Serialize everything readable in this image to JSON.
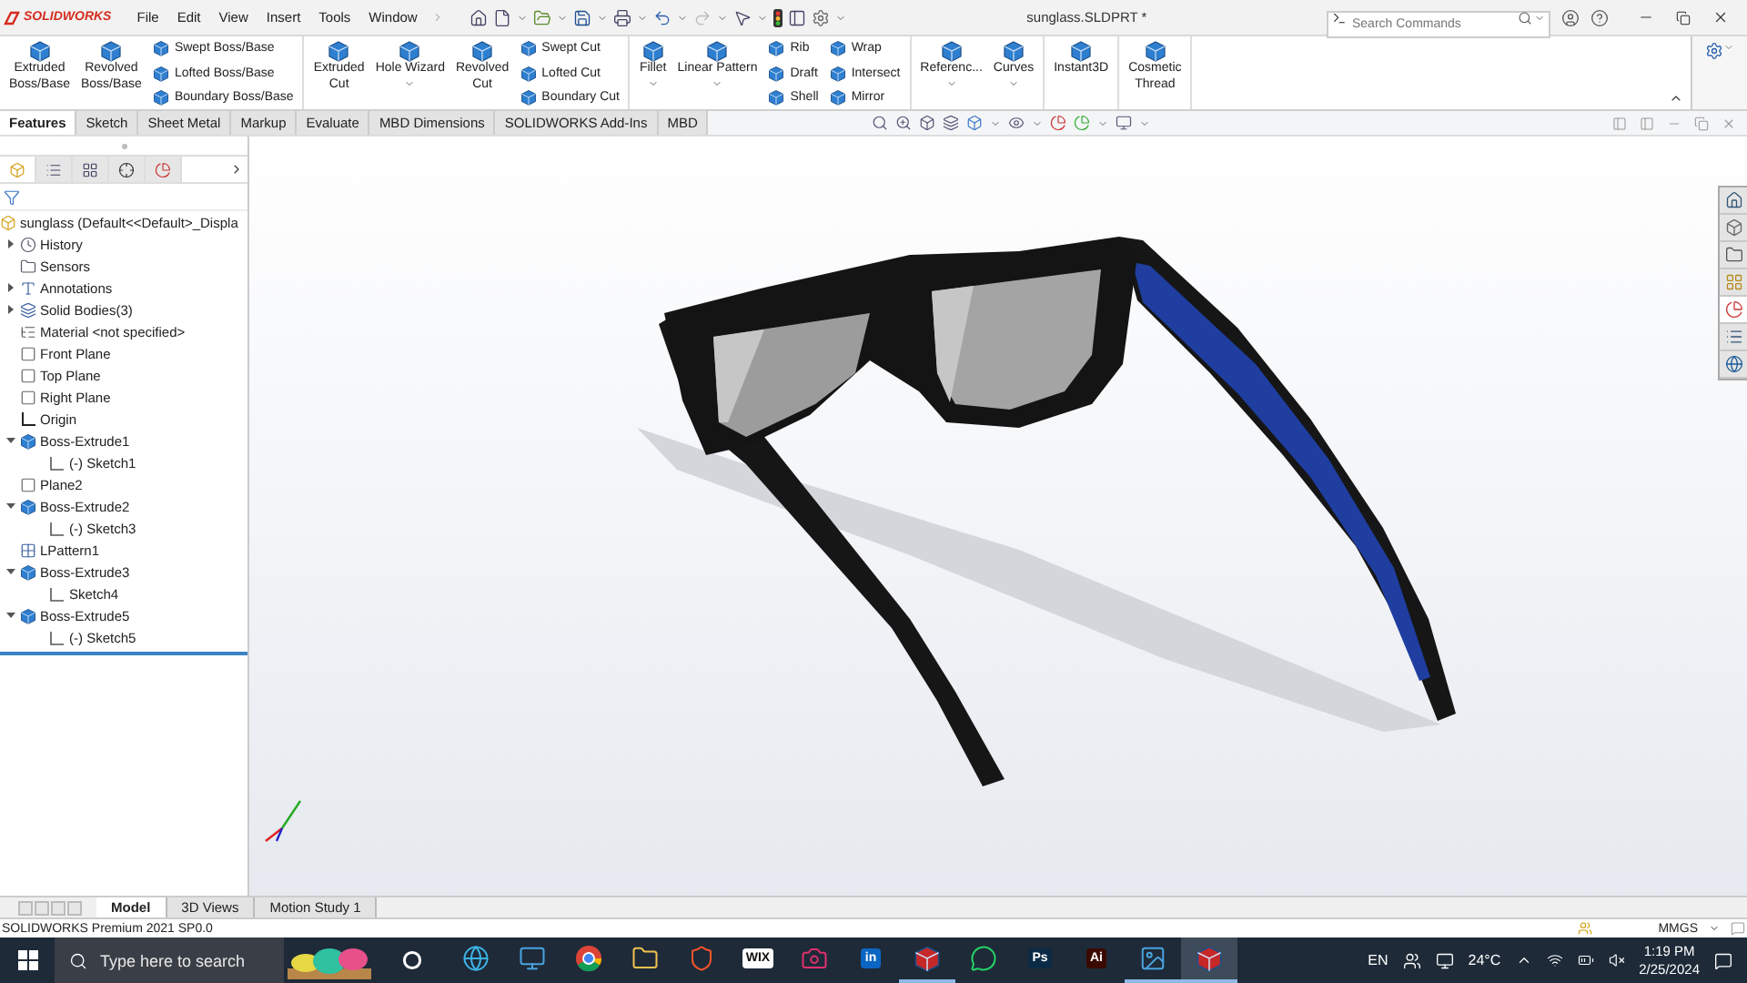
{
  "title_bar": {
    "logo": "SOLIDWORKS",
    "menus": [
      "File",
      "Edit",
      "View",
      "Insert",
      "Tools",
      "Window"
    ],
    "document_title": "sunglass.SLDPRT *",
    "search": {
      "placeholder": "Search Commands"
    }
  },
  "ribbon": {
    "groups": [
      {
        "items": [
          {
            "kind": "large",
            "label": "Extruded\nBoss/Base",
            "has_menu": false
          },
          {
            "kind": "large",
            "label": "Revolved\nBoss/Base",
            "has_menu": false
          },
          {
            "kind": "stack",
            "entries": [
              "Swept Boss/Base",
              "Lofted Boss/Base",
              "Boundary Boss/Base"
            ]
          }
        ]
      },
      {
        "items": [
          {
            "kind": "large",
            "label": "Extruded\nCut",
            "has_menu": false
          },
          {
            "kind": "large",
            "label": "Hole Wizard",
            "has_menu": true
          },
          {
            "kind": "large",
            "label": "Revolved\nCut",
            "has_menu": false
          },
          {
            "kind": "stack",
            "entries": [
              "Swept Cut",
              "Lofted Cut",
              "Boundary Cut"
            ]
          }
        ]
      },
      {
        "items": [
          {
            "kind": "large",
            "label": "Fillet",
            "has_menu": true
          },
          {
            "kind": "large",
            "label": "Linear Pattern",
            "has_menu": true
          },
          {
            "kind": "stack",
            "entries": [
              "Rib",
              "Draft",
              "Shell"
            ]
          },
          {
            "kind": "stack",
            "entries": [
              "Wrap",
              "Intersect",
              "Mirror"
            ]
          }
        ]
      },
      {
        "items": [
          {
            "kind": "large",
            "label": "Referenc...",
            "has_menu": true
          },
          {
            "kind": "large",
            "label": "Curves",
            "has_menu": true
          }
        ]
      },
      {
        "items": [
          {
            "kind": "large",
            "label": "Instant3D",
            "has_menu": false
          }
        ]
      },
      {
        "items": [
          {
            "kind": "large",
            "label": "Cosmetic\nThread",
            "has_menu": false
          }
        ]
      }
    ]
  },
  "command_tabs": [
    {
      "label": "Features",
      "selected": true
    },
    {
      "label": "Sketch",
      "selected": false
    },
    {
      "label": "Sheet Metal",
      "selected": false
    },
    {
      "label": "Markup",
      "selected": false
    },
    {
      "label": "Evaluate",
      "selected": false
    },
    {
      "label": "MBD Dimensions",
      "selected": false
    },
    {
      "label": "SOLIDWORKS Add-Ins",
      "selected": false
    },
    {
      "label": "MBD",
      "selected": false
    }
  ],
  "feature_tree": {
    "tabs": [
      {
        "selected": true
      },
      {
        "selected": false
      },
      {
        "selected": false
      },
      {
        "selected": false
      },
      {
        "selected": false
      }
    ],
    "root": "sunglass  (Default<<Default>_Displa",
    "items": [
      {
        "kind": "history",
        "label": "History",
        "expanded": false
      },
      {
        "kind": "sensors",
        "label": "Sensors"
      },
      {
        "kind": "annotations",
        "label": "Annotations",
        "expanded": false
      },
      {
        "kind": "bodies",
        "label": "Solid Bodies(3)",
        "expanded": false
      },
      {
        "kind": "material",
        "label": "Material <not specified>"
      },
      {
        "kind": "plane",
        "label": "Front Plane"
      },
      {
        "kind": "plane",
        "label": "Top Plane"
      },
      {
        "kind": "plane",
        "label": "Right Plane"
      },
      {
        "kind": "origin",
        "label": "Origin"
      },
      {
        "kind": "feature",
        "label": "Boss-Extrude1",
        "expanded": true,
        "children": [
          {
            "kind": "sketch",
            "label": "(-) Sketch1"
          }
        ]
      },
      {
        "kind": "plane",
        "label": "Plane2"
      },
      {
        "kind": "feature",
        "label": "Boss-Extrude2",
        "expanded": true,
        "children": [
          {
            "kind": "sketch",
            "label": "(-) Sketch3"
          }
        ]
      },
      {
        "kind": "pattern",
        "label": "LPattern1"
      },
      {
        "kind": "feature",
        "label": "Boss-Extrude3",
        "expanded": true,
        "children": [
          {
            "kind": "sketch",
            "label": "Sketch4"
          }
        ]
      },
      {
        "kind": "feature",
        "label": "Boss-Extrude5",
        "expanded": true,
        "children": [
          {
            "kind": "sketch",
            "label": "(-) Sketch5"
          }
        ]
      }
    ]
  },
  "task_pane": [
    {
      "kind": "home",
      "selected": false
    },
    {
      "kind": "parts",
      "selected": false
    },
    {
      "kind": "folder",
      "selected": false
    },
    {
      "kind": "grid",
      "selected": false
    },
    {
      "kind": "appearance",
      "selected": true
    },
    {
      "kind": "list",
      "selected": false
    },
    {
      "kind": "globe",
      "selected": false
    }
  ],
  "bottom_tabs": [
    {
      "label": "Model",
      "selected": true
    },
    {
      "label": "3D Views",
      "selected": false
    },
    {
      "label": "Motion Study 1",
      "selected": false
    }
  ],
  "status_bar": {
    "text": "SOLIDWORKS Premium 2021 SP0.0",
    "units": "MMGS"
  },
  "taskbar": {
    "search": {
      "placeholder": "Type here to search"
    },
    "apps": [
      {
        "kind": "browser",
        "running": false,
        "active": false
      },
      {
        "kind": "remote",
        "running": false,
        "active": false
      },
      {
        "kind": "chrome",
        "running": false,
        "active": false
      },
      {
        "kind": "files",
        "running": false,
        "active": false
      },
      {
        "kind": "shield",
        "running": false,
        "active": false
      },
      {
        "kind": "tile",
        "label": "WIX",
        "color": "#ffffff",
        "running": false,
        "active": false
      },
      {
        "kind": "camera",
        "running": false,
        "active": false
      },
      {
        "kind": "tile",
        "label": "in",
        "color": "#0a66c2",
        "running": false,
        "active": false
      },
      {
        "kind": "cube",
        "running": true,
        "active": false
      },
      {
        "kind": "chat",
        "running": false,
        "active": false
      },
      {
        "kind": "tile",
        "label": "Ps",
        "color": "#0b2a45",
        "running": false,
        "active": false
      },
      {
        "kind": "tile",
        "label": "Ai",
        "color": "#3a0a00",
        "running": false,
        "active": false
      },
      {
        "kind": "photos",
        "running": true,
        "active": false
      },
      {
        "kind": "cube",
        "running": true,
        "active": true
      }
    ],
    "tray": {
      "language": "EN",
      "temperature": "24°C",
      "time": "1:19 PM",
      "date": "2/25/2024"
    }
  }
}
